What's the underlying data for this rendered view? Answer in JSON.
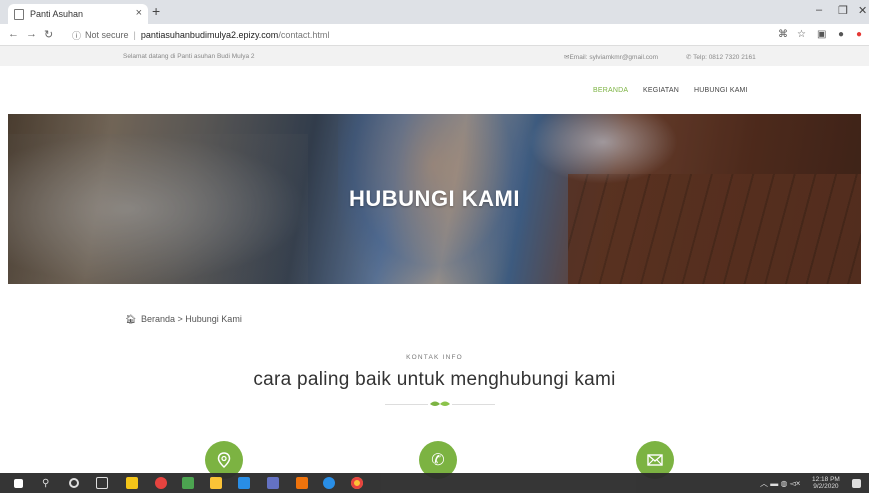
{
  "browser": {
    "tab_title": "Panti Asuhan",
    "close_glyph": "×",
    "new_tab_glyph": "+",
    "security_label": "Not secure",
    "url_host": "pantiasuhanbudimulya2.epizy.com",
    "url_path": "/contact.html",
    "win_minimize": "–",
    "win_restore": "❐",
    "win_close": "✕"
  },
  "topstrip": {
    "welcome": "Selamat datang di Panti asuhan Budi Mulya 2",
    "email": "Email: sylviamkmr@gmail.com",
    "phone": "Telp: 0812 7320 2161"
  },
  "nav": {
    "items": [
      "BERANDA",
      "KEGIATAN",
      "HUBUNGI KAMI"
    ],
    "active_color": "#7cb342"
  },
  "hero": {
    "title": "HUBUNGI KAMI"
  },
  "breadcrumb": {
    "home": "Beranda",
    "separator": ">",
    "current": "Hubungi Kami"
  },
  "contact": {
    "eyebrow": "KONTAK INFO",
    "headline": "cara paling baik untuk menghubungi kami",
    "icons": [
      "location-icon",
      "phone-icon",
      "mail-icon"
    ],
    "accent": "#7cb342"
  },
  "taskbar": {
    "time": "12:18 PM",
    "date": "9/2/2020"
  }
}
